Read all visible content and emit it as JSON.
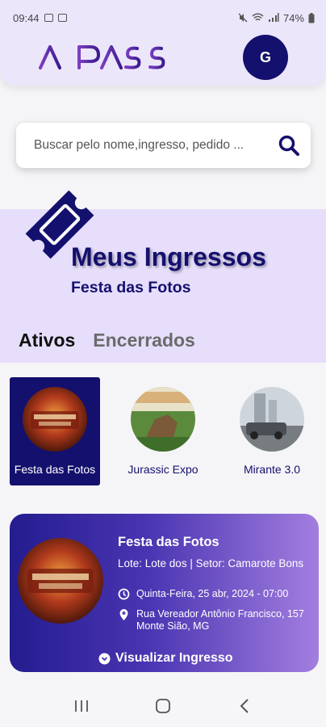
{
  "status": {
    "time": "09:44",
    "battery": "74%"
  },
  "header": {
    "logo_text": "AI PASS",
    "avatar_letter": "G"
  },
  "search": {
    "placeholder": "Buscar pelo nome,ingresso, pedido ..."
  },
  "hero": {
    "title": "Meus Ingressos",
    "subtitle": "Festa das Fotos"
  },
  "tabs": [
    {
      "label": "Ativos",
      "active": true
    },
    {
      "label": "Encerrados",
      "active": false
    }
  ],
  "events": [
    {
      "label": "Festa das Fotos",
      "selected": true
    },
    {
      "label": "Jurassic Expo",
      "selected": false
    },
    {
      "label": "Mirante 3.0",
      "selected": false
    }
  ],
  "card": {
    "title": "Festa das Fotos",
    "info": "Lote: Lote dos | Setor: Camarote Bons",
    "date": "Quinta-Feira, 25 abr, 2024 - 07:00",
    "address": "Rua Vereador Antônio Francisco, 157 Monte Sião, MG",
    "button": "Visualizar Ingresso"
  },
  "colors": {
    "primary": "#14106e",
    "accent": "#7b3fbf",
    "hero_bg": "#e6defb"
  }
}
